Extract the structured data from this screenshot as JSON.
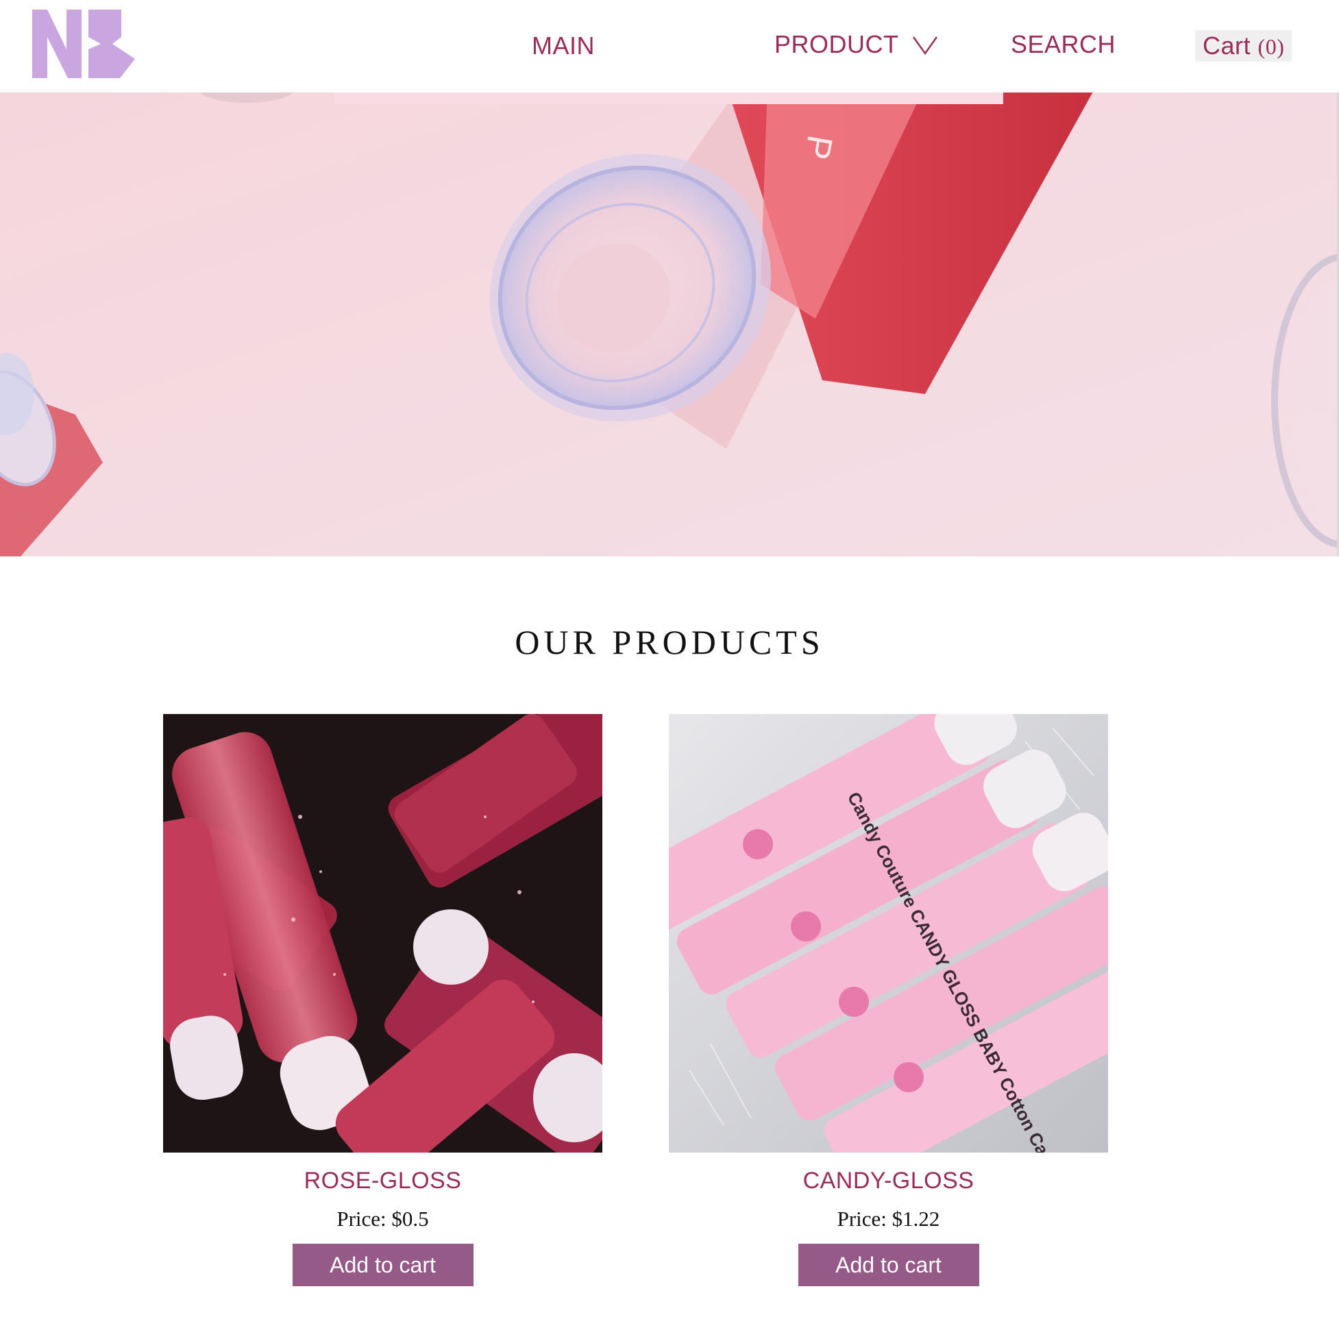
{
  "header": {
    "logo_text": "NB",
    "nav": {
      "main": "MAIN",
      "product": "PRODUCT",
      "search": "SEARCH",
      "cart_label": "Cart",
      "cart_count": "(0)"
    }
  },
  "hero": {
    "product_lettering": "P"
  },
  "products_section": {
    "title": "OUR PRODUCTS",
    "items": [
      {
        "name": "ROSE-GLOSS",
        "price": "Price: $0.5",
        "button": "Add to cart",
        "image_lettering": ""
      },
      {
        "name": "CANDY-GLOSS",
        "price": "Price: $1.22",
        "button": "Add to cart",
        "image_lettering": "Candy Couture CANDY GLOSS BABY Cotton Candy"
      }
    ]
  },
  "colors": {
    "accent": "#9b2c5a",
    "button": "#955a87",
    "logo": "#c9a6e0",
    "hero_bg": "#f4d8e0"
  },
  "icons": {
    "product_dropdown": "chevron-down-icon"
  }
}
